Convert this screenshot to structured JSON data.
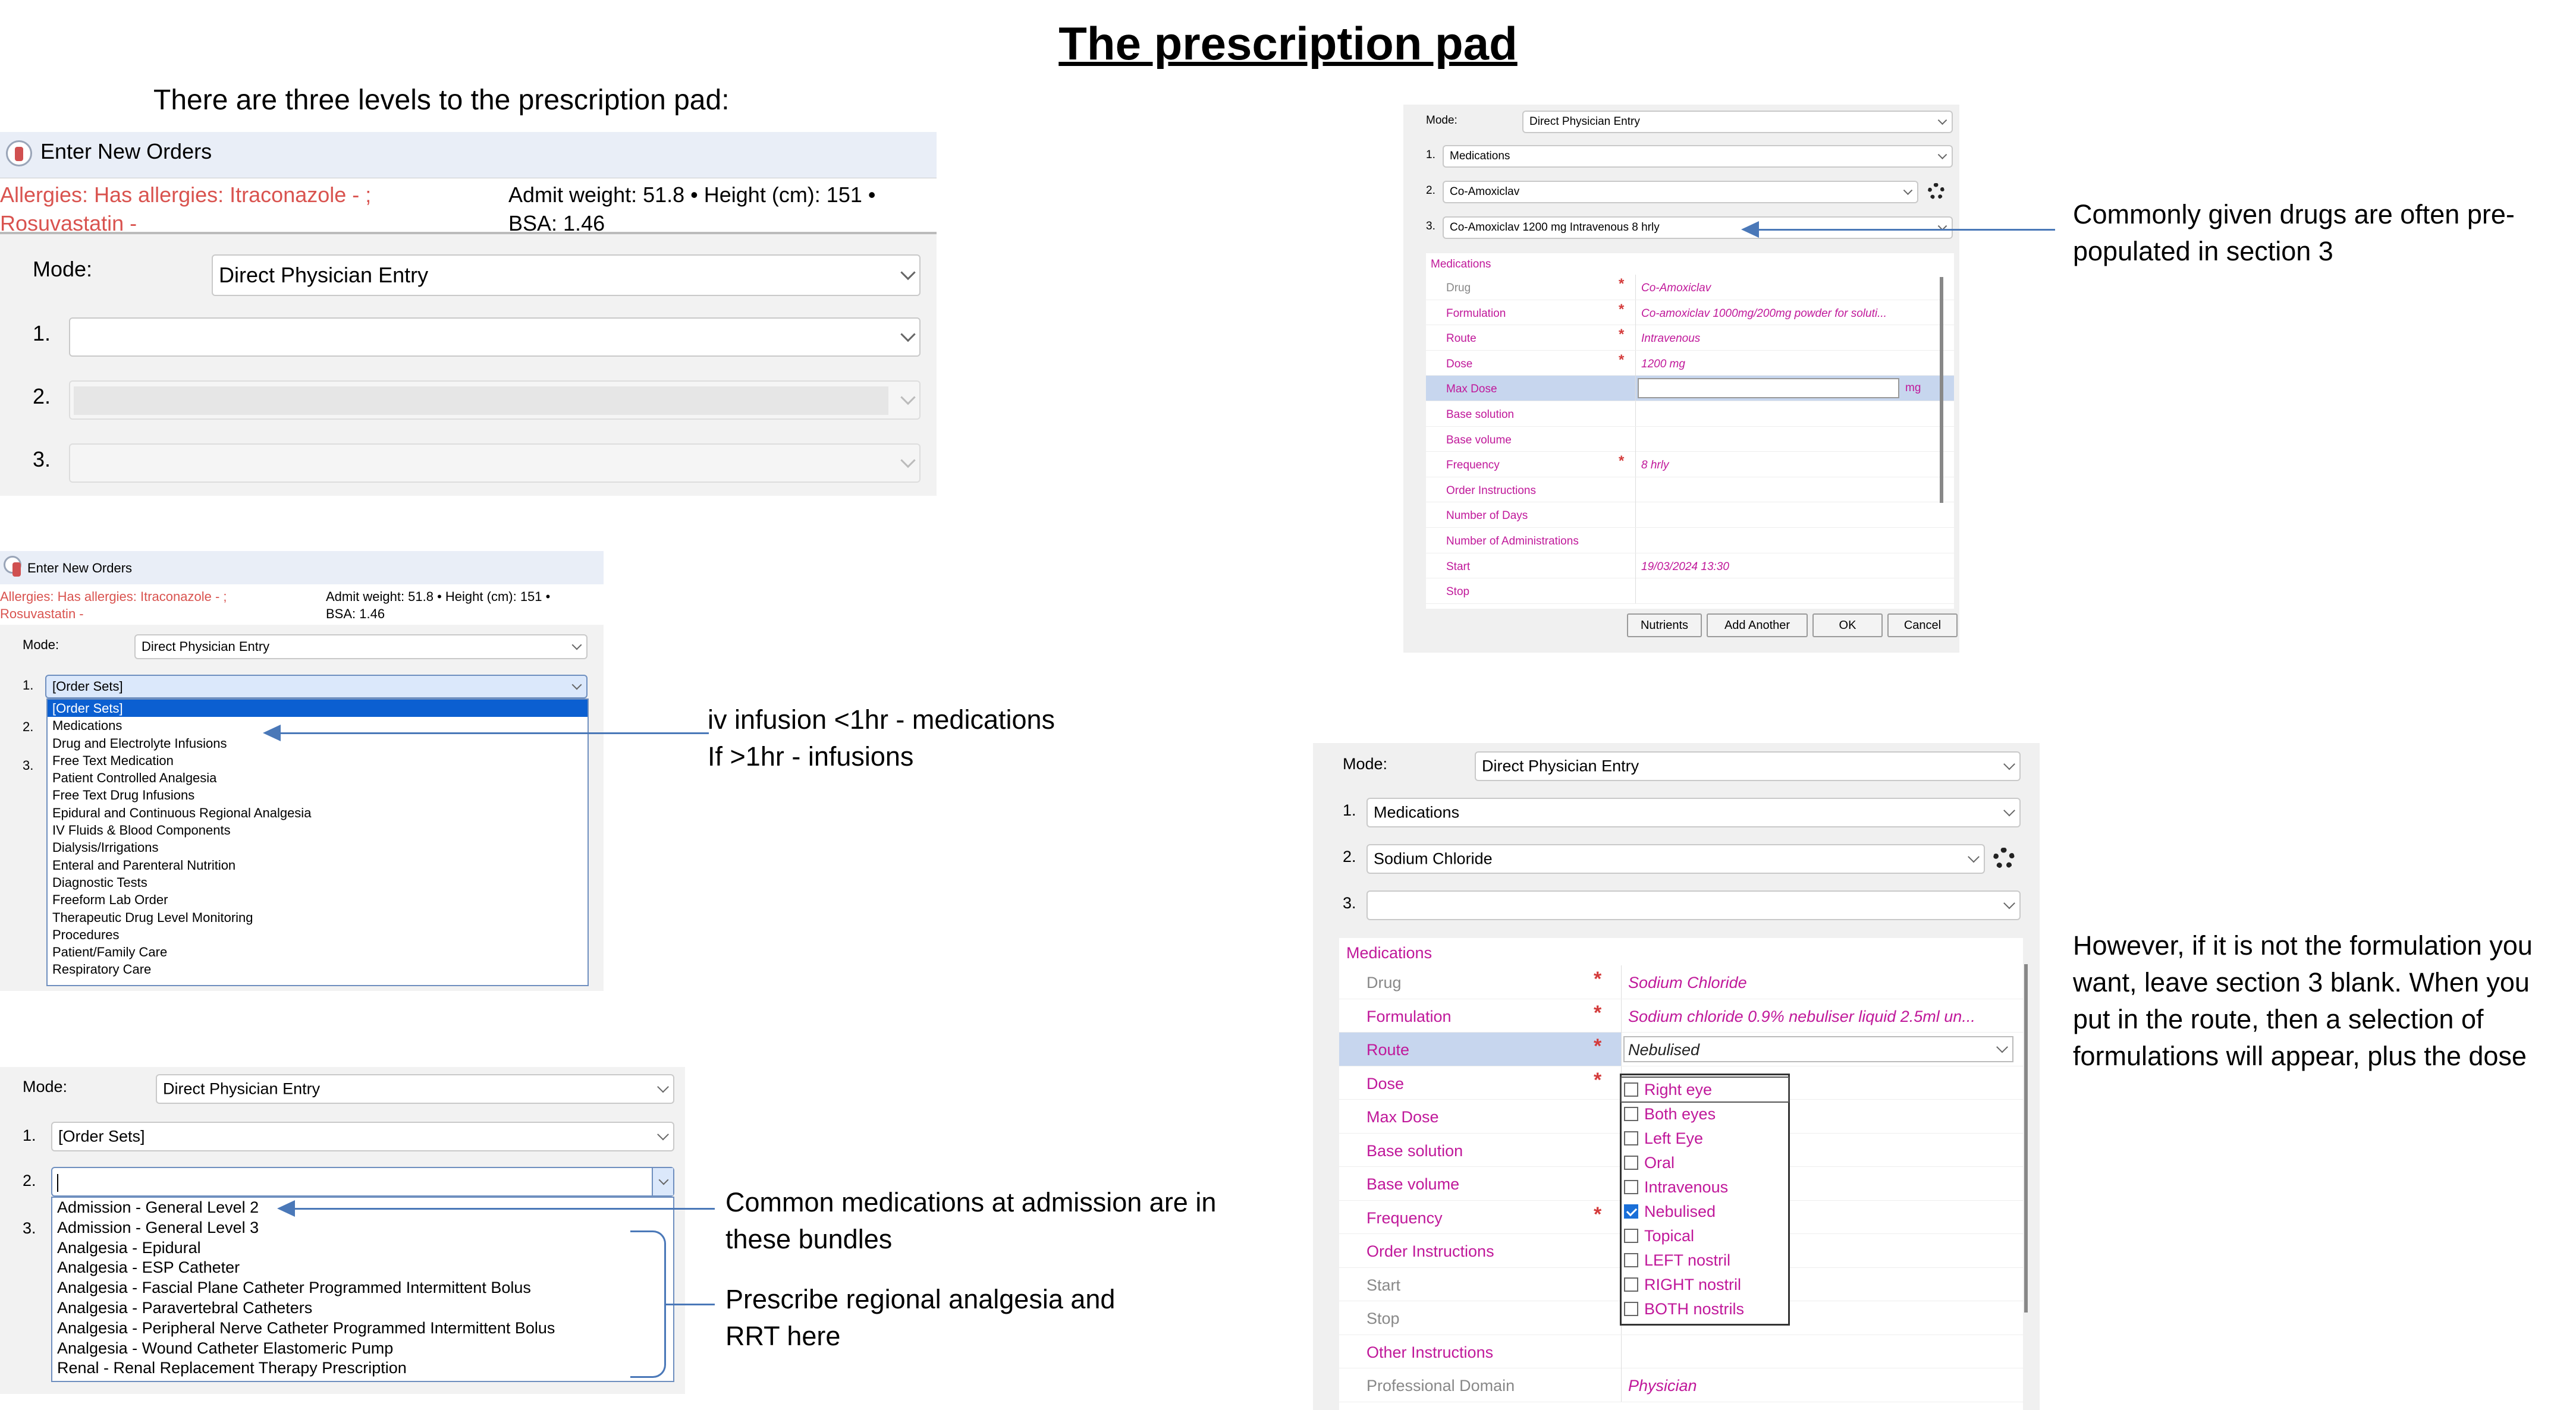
{
  "page": {
    "title": "The prescription pad",
    "intro": "There are three levels to the prescription pad:"
  },
  "panel1": {
    "window_title": "Enter New Orders",
    "allergy": "Allergies: Has allergies: Itraconazole - ; Rosuvastatin -",
    "admit_line1": "Admit weight: 51.8  •  Height (cm): 151  •",
    "admit_line2": "BSA: 1.46",
    "mode_label": "Mode:",
    "mode_value": "Direct Physician Entry",
    "level1": "1.",
    "level2": "2.",
    "level3": "3."
  },
  "panel2": {
    "window_title": "Enter New Orders",
    "allergy_line1": "Allergies: Has allergies: Itraconazole - ;",
    "allergy_line2": "Rosuvastatin -",
    "admit_line1": "Admit weight: 51.8  •  Height (cm): 151  •",
    "admit_line2": "BSA: 1.46",
    "mode_label": "Mode:",
    "mode_value": "Direct Physician Entry",
    "level1": "1.",
    "level1_value": "[Order Sets]",
    "level2": "2.",
    "level3": "3.",
    "items": [
      "[Order Sets]",
      "Medications",
      "Drug and Electrolyte Infusions",
      "Free Text Medication",
      "Patient Controlled Analgesia",
      "Free Text Drug Infusions",
      "Epidural and Continuous Regional Analgesia",
      "IV Fluids & Blood Components",
      "Dialysis/Irrigations",
      "Enteral and Parenteral Nutrition",
      "Diagnostic Tests",
      "Freeform Lab Order",
      "Therapeutic Drug Level Monitoring",
      "Procedures",
      "Patient/Family Care",
      "Respiratory Care"
    ],
    "selected_index": 0
  },
  "note2": "iv infusion <1hr - medications\nIf >1hr - infusions",
  "panel3": {
    "mode_label": "Mode:",
    "mode_value": "Direct Physician Entry",
    "level1": "1.",
    "level1_value": "[Order Sets]",
    "level2": "2.",
    "level3": "3.",
    "items": [
      "Admission - General Level 2",
      "Admission - General Level 3",
      "Analgesia - Epidural",
      "Analgesia - ESP Catheter",
      "Analgesia - Fascial Plane Catheter Programmed Intermittent Bolus",
      "Analgesia - Paravertebral Catheters",
      "Analgesia - Peripheral Nerve Catheter Programmed Intermittent Bolus",
      "Analgesia - Wound Catheter Elastomeric Pump",
      "Renal - Renal Replacement Therapy Prescription"
    ]
  },
  "note3a": "Common medications at admission are in\nthese bundles",
  "note3b": "Prescribe regional analgesia and\nRRT here",
  "panel4": {
    "mode_label": "Mode:",
    "mode_value": "Direct Physician Entry",
    "level1": "1.",
    "level1_value": "Medications",
    "level2": "2.",
    "level2_value": "Co-Amoxiclav",
    "level3": "3.",
    "level3_value": "Co-Amoxiclav 1200 mg Intravenous 8 hrly",
    "group": "Medications",
    "rows": [
      {
        "label": "Drug",
        "value": "Co-Amoxiclav",
        "req": true,
        "grey": true
      },
      {
        "label": "Formulation",
        "value": "Co-amoxiclav  1000mg/200mg  powder  for soluti...",
        "req": true
      },
      {
        "label": "Route",
        "value": "Intravenous",
        "req": true
      },
      {
        "label": "Dose",
        "value": "1200 mg",
        "req": true
      },
      {
        "label": "Max Dose",
        "value": "",
        "req": false,
        "highlight": true
      },
      {
        "label": "Base solution",
        "value": "",
        "req": false
      },
      {
        "label": "Base volume",
        "value": "",
        "req": false
      },
      {
        "label": "Frequency",
        "value": "8 hrly",
        "req": true
      },
      {
        "label": "Order Instructions",
        "value": "",
        "req": false
      },
      {
        "label": "Number of Days",
        "value": "",
        "req": false
      },
      {
        "label": "Number of Administrations",
        "value": "",
        "req": false
      },
      {
        "label": "Start",
        "value": "19/03/2024 13:30",
        "req": false
      },
      {
        "label": "Stop",
        "value": "",
        "req": false
      }
    ],
    "max_dose_unit": "mg",
    "buttons": [
      "Nutrients",
      "Add Another",
      "OK",
      "Cancel"
    ]
  },
  "note4": "Commonly given drugs are often pre-\npopulated in section 3",
  "panel5": {
    "mode_label": "Mode:",
    "mode_value": "Direct Physician Entry",
    "level1": "1.",
    "level1_value": "Medications",
    "level2": "2.",
    "level2_value": "Sodium Chloride",
    "level3": "3.",
    "group": "Medications",
    "rows": [
      {
        "label": "Drug",
        "value": "Sodium Chloride",
        "req": true,
        "grey": true
      },
      {
        "label": "Formulation",
        "value": "Sodium  chloride  0.9%  nebuliser  liquid  2.5ml  un...",
        "req": true
      },
      {
        "label": "Route",
        "value": "Nebulised",
        "req": true,
        "highlight": true
      },
      {
        "label": "Dose",
        "value": "",
        "req": true
      },
      {
        "label": "Max Dose",
        "value": "",
        "req": false
      },
      {
        "label": "Base solution",
        "value": "",
        "req": false
      },
      {
        "label": "Base volume",
        "value": "",
        "req": false
      },
      {
        "label": "Frequency",
        "value": "",
        "req": true
      },
      {
        "label": "Order Instructions",
        "value": "",
        "req": false
      },
      {
        "label": "Start",
        "value": "",
        "req": false,
        "grey": true
      },
      {
        "label": "Stop",
        "value": "",
        "req": false,
        "grey": true
      },
      {
        "label": "Other Instructions",
        "value": "",
        "req": false
      },
      {
        "label": "Professional Domain",
        "value": "Physician",
        "req": false,
        "grey": true
      }
    ],
    "route_options": [
      {
        "label": "Right eye",
        "checked": false
      },
      {
        "label": "Both eyes",
        "checked": false
      },
      {
        "label": "Left Eye",
        "checked": false
      },
      {
        "label": "Oral",
        "checked": false
      },
      {
        "label": "Intravenous",
        "checked": false
      },
      {
        "label": "Nebulised",
        "checked": true
      },
      {
        "label": "Topical",
        "checked": false
      },
      {
        "label": "LEFT nostril",
        "checked": false
      },
      {
        "label": "RIGHT nostril",
        "checked": false
      },
      {
        "label": "BOTH nostrils",
        "checked": false
      }
    ]
  },
  "note5": "However, if it is not the formulation you\nwant, leave section 3 blank. When you\nput in the route, then a selection of\nformulations will appear, plus the dose",
  "colors": {
    "allergy": "#d9534f",
    "selection": "#0b5fd1",
    "accent": "#4a78b8",
    "value": "#c0189a"
  }
}
